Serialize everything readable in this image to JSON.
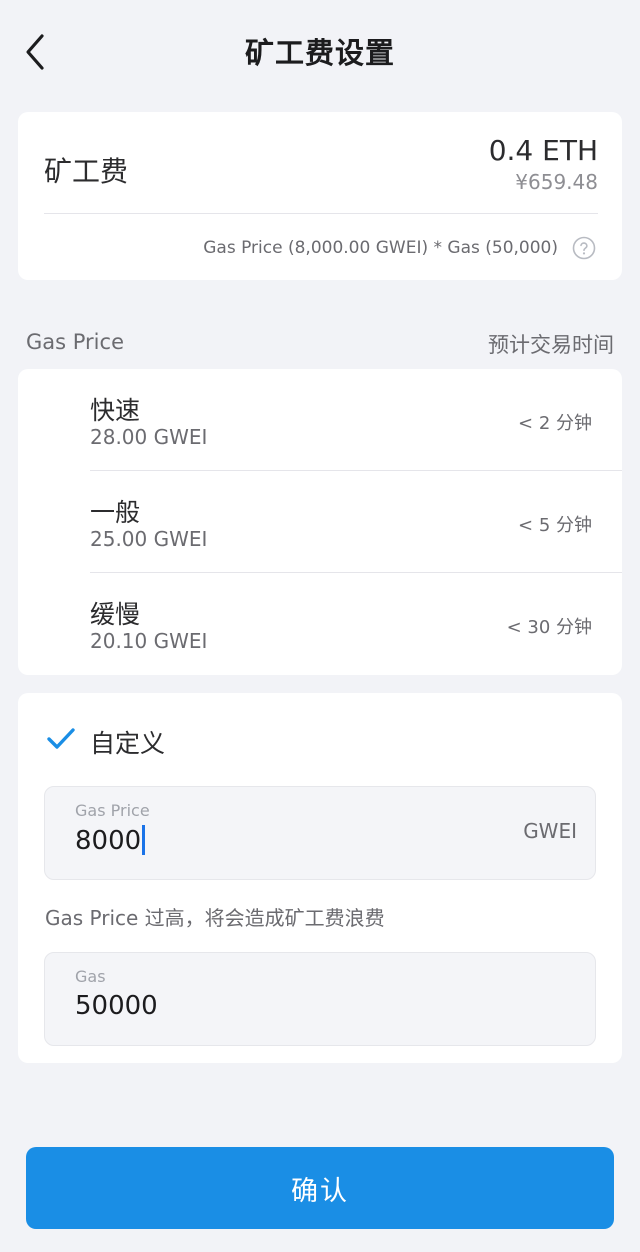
{
  "header": {
    "title": "矿工费设置",
    "back_icon": "chevron-left-icon"
  },
  "fee_summary": {
    "label": "矿工费",
    "eth_amount": "0.4 ETH",
    "cny_amount": "¥659.48",
    "formula": "Gas Price (8,000.00 GWEI) * Gas (50,000)",
    "help_icon": "question-circle-icon"
  },
  "section": {
    "left_label": "Gas Price",
    "right_label": "预计交易时间"
  },
  "speed_options": [
    {
      "name": "快速",
      "price": "28.00 GWEI",
      "time": "< 2 分钟"
    },
    {
      "name": "一般",
      "price": "25.00 GWEI",
      "time": "< 5 分钟"
    },
    {
      "name": "缓慢",
      "price": "20.10 GWEI",
      "time": "< 30 分钟"
    }
  ],
  "custom": {
    "label": "自定义",
    "selected": true,
    "check_icon": "checkmark-icon",
    "gas_price_field": {
      "label": "Gas Price",
      "value": "8000",
      "unit": "GWEI"
    },
    "warning": "Gas Price 过高，将会造成矿工费浪费",
    "gas_field": {
      "label": "Gas",
      "value": "50000"
    }
  },
  "confirm_button": {
    "label": "确认"
  },
  "colors": {
    "accent": "#1a8ee5",
    "background": "#f2f3f7",
    "card": "#ffffff"
  }
}
